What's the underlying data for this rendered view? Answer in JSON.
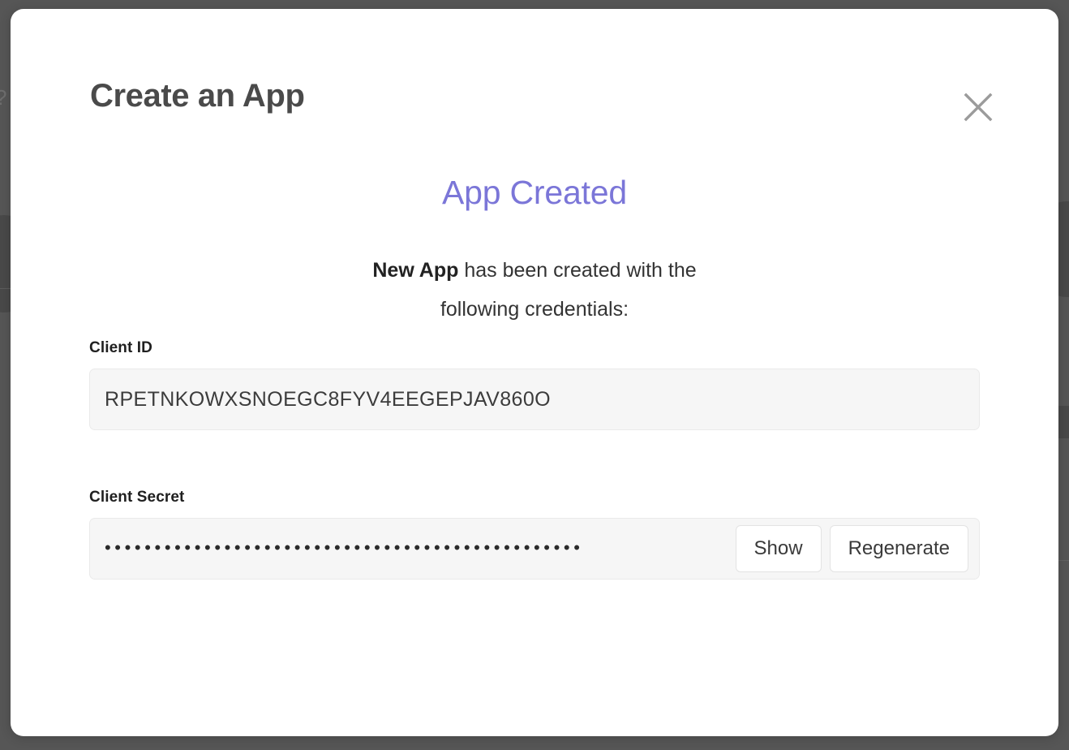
{
  "modal": {
    "title": "Create an App",
    "close_icon": "close-icon",
    "status_heading": "App Created",
    "message": {
      "app_name": "New App",
      "rest": " has been created with the following credentials:"
    },
    "accent_color": "#7b76d8",
    "fields": [
      {
        "label": "Client ID",
        "value": "RPETNKOWXSNOEGC8FYV4EEGEPJAV860O",
        "masked": false
      },
      {
        "label": "Client Secret",
        "value": "••••••••••••••••••••••••••••••••••••••••••••••••",
        "masked": true
      }
    ],
    "secret_actions": [
      {
        "label": "Show"
      },
      {
        "label": "Regenerate"
      }
    ]
  }
}
